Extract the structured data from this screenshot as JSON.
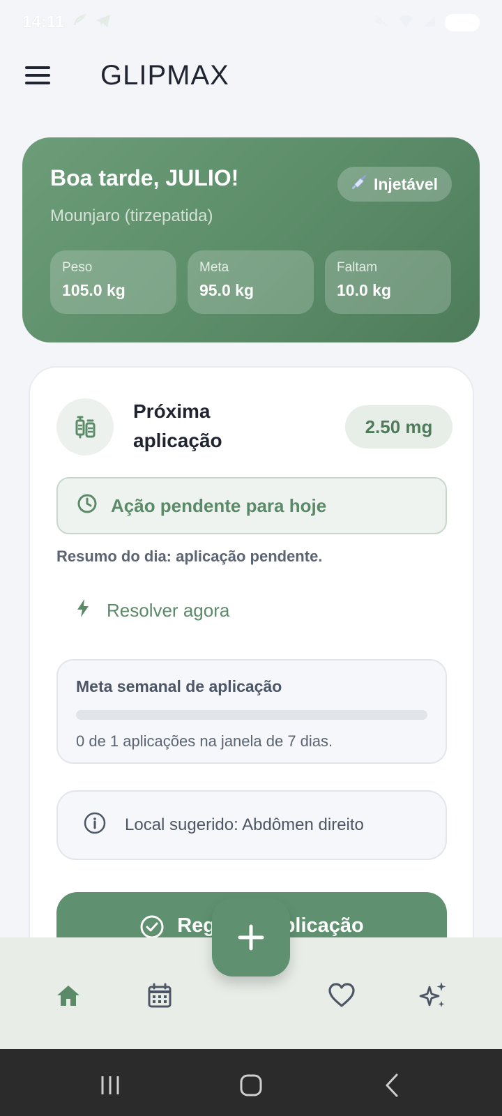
{
  "status_bar": {
    "time": "14:11",
    "battery": "100"
  },
  "app_bar": {
    "title": "GLIPMAX",
    "menu_icon": "hamburger-menu-icon"
  },
  "hero": {
    "greeting": "Boa tarde, JULIO!",
    "medication": "Mounjaro (tirzepatida)",
    "badge": {
      "icon": "syringe-icon",
      "label": "Injetável"
    },
    "stats": [
      {
        "label": "Peso",
        "value": "105.0 kg"
      },
      {
        "label": "Meta",
        "value": "95.0 kg"
      },
      {
        "label": "Faltam",
        "value": "10.0 kg"
      }
    ]
  },
  "next_application": {
    "title": "Próxima aplicação",
    "dose": "2.50 mg",
    "pending": "Ação pendente para hoje",
    "summary": "Resumo do dia: aplicação pendente.",
    "resolve": "Resolver agora",
    "weekly": {
      "title": "Meta semanal de aplicação",
      "progress_fraction": 0,
      "text": "0 de 1 aplicações na janela de 7 dias."
    },
    "suggested_site": "Local sugerido: Abdômen direito",
    "register_label": "Registrar aplicação"
  },
  "colors": {
    "accent": "#5f9170",
    "accent_text": "#5a8a67"
  },
  "bottom_nav": [
    "home-icon",
    "calendar-icon",
    "add-icon",
    "heart-icon",
    "sparkles-icon"
  ]
}
